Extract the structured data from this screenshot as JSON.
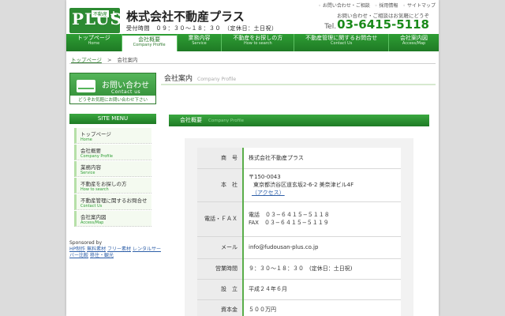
{
  "header": {
    "logo_big": "PLUS",
    "logo_small": "不動産",
    "logo_plus": "+",
    "company_name": "株式会社不動産プラス",
    "hours": "受付時間　０９：３０〜１８：３０　（定休日：土日祝）",
    "top_links": [
      "お問い合わせ・ご相談",
      "採用情報",
      "サイトマップ"
    ],
    "tel_note": "お問い合わせ・ご相談はお気軽にどうぞ",
    "tel_label": "Tel.",
    "tel_number": "03-6415-5118"
  },
  "nav": [
    {
      "jp": "トップページ",
      "en": "Home"
    },
    {
      "jp": "会社概要",
      "en": "Company Profile"
    },
    {
      "jp": "業務内容",
      "en": "Service"
    },
    {
      "jp": "不動産をお探しの方",
      "en": "How to search"
    },
    {
      "jp": "不動産管理に関するお問合せ",
      "en": "Contact Us"
    },
    {
      "jp": "会社案内図",
      "en": "Access/Map"
    }
  ],
  "breadcrumb": {
    "home": "トップページ",
    "sep": ">",
    "current": "会社案内"
  },
  "contact_banner": {
    "jp": "お問い合わせ",
    "en": "Contact us",
    "note": "どうぞお気軽にお問い合わせ下さい"
  },
  "site_menu": {
    "title": "SITE MENU",
    "items": [
      {
        "jp": "トップページ",
        "en": "Home"
      },
      {
        "jp": "会社概要",
        "en": "Company Profile"
      },
      {
        "jp": "業務内容",
        "en": "Service"
      },
      {
        "jp": "不動産をお探しの方",
        "en": "How to search"
      },
      {
        "jp": "不動産管理に関するお問合せ",
        "en": "Contact Us"
      },
      {
        "jp": "会社案内図",
        "en": "Access/Map"
      }
    ]
  },
  "sponsor": {
    "label": "Sponsored by",
    "links": [
      "HP制作",
      "無料素材",
      "フリー素材",
      "レンタルサーバー比較",
      "移住・観光"
    ]
  },
  "main": {
    "title": "会社案内",
    "title_en": "Company Profile",
    "section_title": "会社概要",
    "section_title_en": "Company Profile",
    "rows": [
      {
        "key": "商　号",
        "value": "株式会社不動産プラス"
      },
      {
        "key": "本　社",
        "postal": "〒150-0043",
        "address": "東京都渋谷区道玄坂2-6-2 美奈津ビル4F",
        "access": "（アクセス）"
      },
      {
        "key": "電話・ＦＡＸ",
        "tel": "電話　０３−６４１５−５１１８",
        "fax": "FAX　０３−６４１５−５１１９"
      },
      {
        "key": "メール",
        "value": "info@fudousan-plus.co.jp"
      },
      {
        "key": "営業時間",
        "value": "９：３０〜１８：３０　(定休日：土日祝)"
      },
      {
        "key": "設　立",
        "value": "平成２４年６月"
      },
      {
        "key": "資本金",
        "value": "５００万円"
      }
    ]
  }
}
